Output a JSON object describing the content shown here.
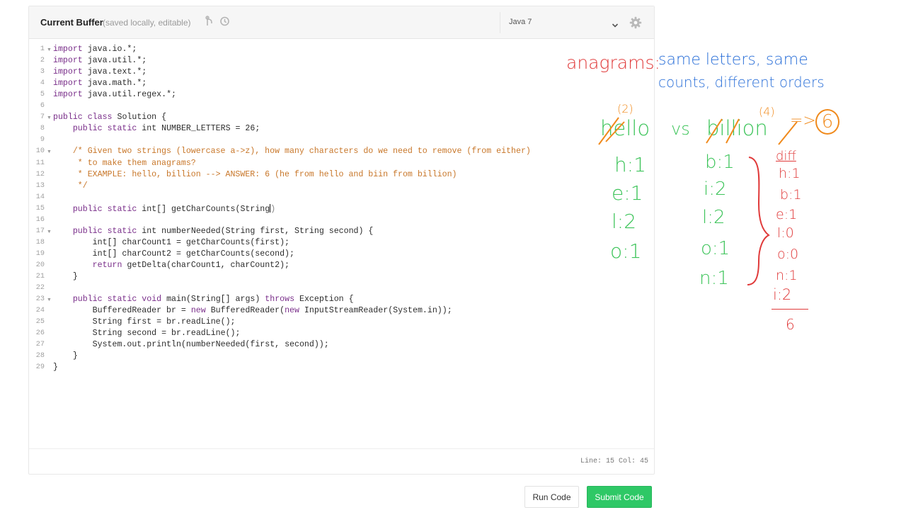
{
  "toolbar": {
    "title": "Current Buffer",
    "subtitle": "(saved locally, editable)",
    "language": "Java 7"
  },
  "code_lines": [
    "import java.io.*;",
    "import java.util.*;",
    "import java.text.*;",
    "import java.math.*;",
    "import java.util.regex.*;",
    "",
    "public class Solution {",
    "    public static int NUMBER_LETTERS = 26;",
    "",
    "    /* Given two strings (lowercase a->z), how many characters do we need to remove (from either)",
    "     * to make them anagrams?",
    "     * EXAMPLE: hello, billion --> ANSWER: 6 (he from hello and biin from billion)",
    "     */",
    "",
    "    public static int[] getCharCounts(String)",
    "",
    "    public static int numberNeeded(String first, String second) {",
    "        int[] charCount1 = getCharCounts(first);",
    "        int[] charCount2 = getCharCounts(second);",
    "        return getDelta(charCount1, charCount2);",
    "    }",
    "",
    "    public static void main(String[] args) throws Exception {",
    "        BufferedReader br = new BufferedReader(new InputStreamReader(System.in));",
    "        String first = br.readLine();",
    "        String second = br.readLine();",
    "        System.out.println(numberNeeded(first, second));",
    "    }",
    "}"
  ],
  "fold_lines": [
    1,
    7,
    10,
    17,
    23
  ],
  "status": "Line: 15 Col: 45",
  "buttons": {
    "run": "Run Code",
    "submit": "Submit Code"
  },
  "notes": {
    "anagrams": "anagrams:",
    "definition_1": "same letters, same",
    "definition_2": "counts, different orders",
    "word1": "hello",
    "vs": "vs",
    "word2": "billion",
    "removed1": "(2)",
    "removed2": "(4)",
    "arrow": "=>",
    "result": "6",
    "counts1": [
      "h:1",
      "e:1",
      "l:2",
      "o:1"
    ],
    "counts2": [
      "b:1",
      "i:2",
      "l:2",
      "o:1",
      "n:1"
    ],
    "diff_label": "diff",
    "diff": [
      "h:1",
      "b:1",
      "e:1",
      "l:0",
      "o:0",
      "n:1",
      "i:2"
    ],
    "total": "6"
  },
  "colors": {
    "submit": "#2ec866",
    "red": "#e03a3a",
    "blue": "#2a6fd8",
    "green": "#3dc45a",
    "orange": "#f08a1c"
  }
}
